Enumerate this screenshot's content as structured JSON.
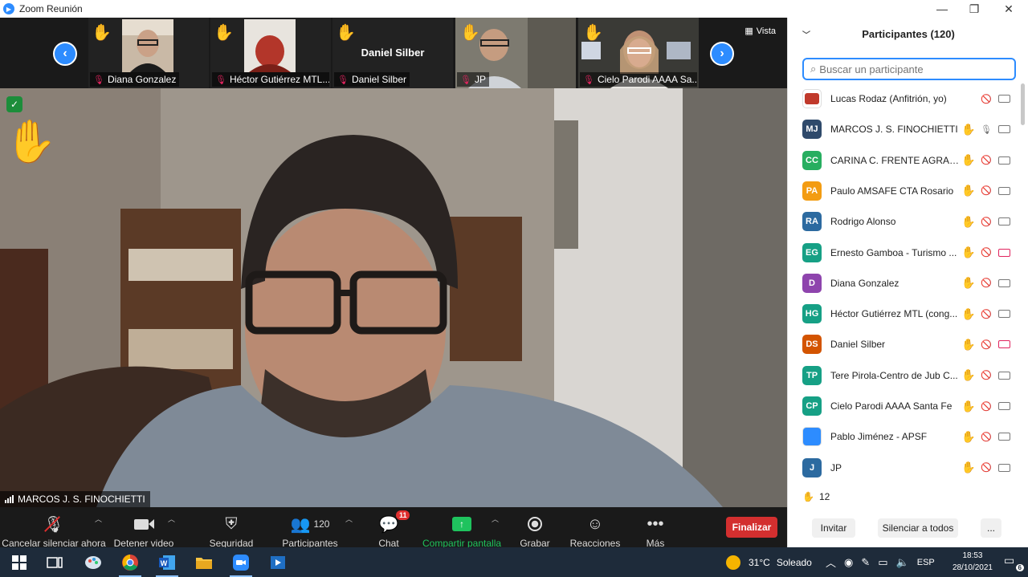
{
  "window": {
    "title": "Zoom Reunión",
    "minimize": "—",
    "restore": "❐",
    "close": "✕"
  },
  "thumbnails": [
    {
      "name": "Diana Gonzalez"
    },
    {
      "name": "Héctor Gutiérrez MTL..."
    },
    {
      "name": "Daniel Silber",
      "display_name": "Daniel Silber"
    },
    {
      "name": "JP"
    },
    {
      "name": "Cielo Parodi AAAA Sa..."
    }
  ],
  "view_label": "Vista",
  "speaker_label": "MARCOS  J. S. FINOCHIETTI",
  "toolbar": {
    "mute": "Cancelar silenciar ahora",
    "video": "Detener video",
    "security": "Seguridad",
    "participants": "Participantes",
    "participants_count": "120",
    "chat": "Chat",
    "chat_badge": "11",
    "share": "Compartir pantalla",
    "record": "Grabar",
    "reactions": "Reacciones",
    "more": "Más",
    "end": "Finalizar"
  },
  "panel": {
    "title": "Participantes (120)",
    "search_placeholder": "Buscar un participante",
    "participants": [
      {
        "initials": "",
        "name": "Lucas Rodaz (Anfitrión, yo)",
        "color": "#ffffff",
        "hand": false,
        "mic": "off",
        "cam": "on",
        "logo": "SANTA FE logo"
      },
      {
        "initials": "MJ",
        "name": "MARCOS  J. S. FINOCHIETTI",
        "color": "#2f4a6b",
        "hand": true,
        "mic": "on",
        "cam": "on"
      },
      {
        "initials": "CC",
        "name": "CARINA C. FRENTE AGRARIO",
        "color": "#27ae60",
        "hand": true,
        "mic": "off",
        "cam": "on"
      },
      {
        "initials": "PA",
        "name": "Paulo AMSAFE CTA Rosario",
        "color": "#f39c12",
        "hand": true,
        "mic": "off",
        "cam": "on"
      },
      {
        "initials": "RA",
        "name": "Rodrigo Alonso",
        "color": "#2c6aa0",
        "hand": true,
        "mic": "off",
        "cam": "on"
      },
      {
        "initials": "EG",
        "name": "Ernesto Gamboa - Turismo ...",
        "color": "#16a085",
        "hand": true,
        "mic": "off",
        "cam": "off"
      },
      {
        "initials": "D",
        "name": "Diana Gonzalez",
        "color": "#8e44ad",
        "hand": true,
        "mic": "off",
        "cam": "on"
      },
      {
        "initials": "HG",
        "name": "Héctor Gutiérrez MTL (cong...",
        "color": "#16a085",
        "hand": true,
        "mic": "off",
        "cam": "on"
      },
      {
        "initials": "DS",
        "name": "Daniel Silber",
        "color": "#d35400",
        "hand": true,
        "mic": "off",
        "cam": "off"
      },
      {
        "initials": "TP",
        "name": "Tere Pirola-Centro de Jub C...",
        "color": "#16a085",
        "hand": true,
        "mic": "off",
        "cam": "on"
      },
      {
        "initials": "CP",
        "name": "Cielo Parodi AAAA Santa Fe",
        "color": "#16a085",
        "hand": true,
        "mic": "off",
        "cam": "on"
      },
      {
        "initials": "",
        "name": "Pablo Jiménez - APSF",
        "color": "#2D8CFF",
        "hand": true,
        "mic": "off",
        "cam": "on",
        "logo": "APSF logo"
      },
      {
        "initials": "J",
        "name": "JP",
        "color": "#2c6aa0",
        "hand": true,
        "mic": "off",
        "cam": "on"
      }
    ],
    "raised_count": "12",
    "invite": "Invitar",
    "mute_all": "Silenciar a todos",
    "more": "..."
  },
  "taskbar": {
    "weather_temp": "31°C",
    "weather_text": "Soleado",
    "lang": "ESP",
    "time": "18:53",
    "date": "28/10/2021",
    "notifications": "6"
  }
}
